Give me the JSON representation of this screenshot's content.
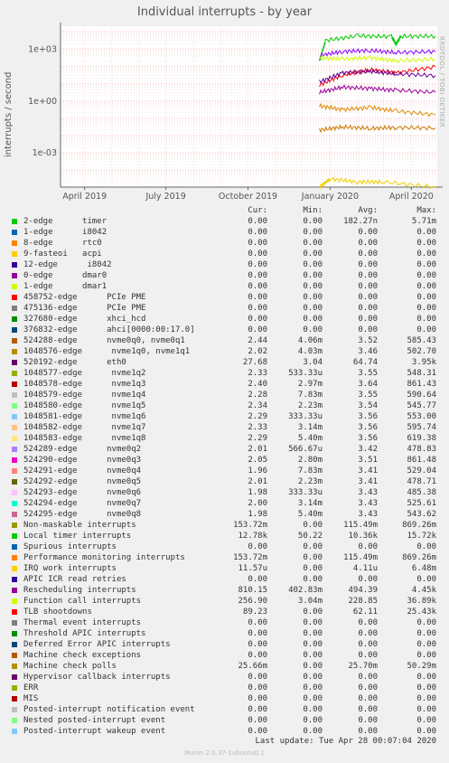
{
  "header": {
    "title": "Individual interrupts - by year",
    "side_label": "RRDTOOL / TOBI OETIKER",
    "footer": "Munin 2.0.37-1ubuntu0.1",
    "last_update": "Last update: Tue Apr 28 00:07:04 2020"
  },
  "legend_header": {
    "cur": "Cur:",
    "min": "Min:",
    "avg": "Avg:",
    "max": "Max:"
  },
  "chart_data": {
    "type": "line",
    "ylabel": "interrupts / second",
    "yscale": "log",
    "yticks": [
      "1e+03",
      "1e+00",
      "1e-03"
    ],
    "xticks": [
      "April 2019",
      "July 2019",
      "October 2019",
      "January 2020",
      "April 2020"
    ],
    "grid": true,
    "series": [
      {
        "name": "Local timer interrupts",
        "color": "#00cc00",
        "values": [
          {
            "x": "2019-12-20",
            "y": 200
          },
          {
            "x": "2019-12-27",
            "y": 3000
          },
          {
            "x": "2020-02-01",
            "y": 5500
          },
          {
            "x": "2020-03-10",
            "y": 5000
          },
          {
            "x": "2020-03-15",
            "y": 1800
          },
          {
            "x": "2020-03-20",
            "y": 5200
          },
          {
            "x": "2020-04-28",
            "y": 5300
          }
        ]
      },
      {
        "name": "Rescheduling interrupts",
        "color": "#8800ff",
        "values": [
          {
            "x": "2019-12-20",
            "y": 400
          },
          {
            "x": "2020-01-15",
            "y": 700
          },
          {
            "x": "2020-02-15",
            "y": 800
          },
          {
            "x": "2020-03-15",
            "y": 600
          },
          {
            "x": "2020-04-28",
            "y": 700
          }
        ]
      },
      {
        "name": "Function call interrupts",
        "color": "#ccff00",
        "values": [
          {
            "x": "2019-12-20",
            "y": 300
          },
          {
            "x": "2020-01-15",
            "y": 250
          },
          {
            "x": "2020-02-15",
            "y": 300
          },
          {
            "x": "2020-03-15",
            "y": 200
          },
          {
            "x": "2020-04-28",
            "y": 250
          }
        ]
      },
      {
        "name": "TLB shootdowns",
        "color": "#ff0000",
        "values": [
          {
            "x": "2019-12-20",
            "y": 8
          },
          {
            "x": "2020-01-15",
            "y": 30
          },
          {
            "x": "2020-02-15",
            "y": 60
          },
          {
            "x": "2020-03-15",
            "y": 40
          },
          {
            "x": "2020-04-28",
            "y": 90
          }
        ]
      },
      {
        "name": "520192-edge eth0",
        "color": "#660099",
        "values": [
          {
            "x": "2019-12-20",
            "y": 12
          },
          {
            "x": "2020-01-15",
            "y": 40
          },
          {
            "x": "2020-02-15",
            "y": 50
          },
          {
            "x": "2020-03-15",
            "y": 35
          },
          {
            "x": "2020-04-28",
            "y": 28
          }
        ]
      },
      {
        "name": "1048578-edge nvme1q3",
        "color": "#990099",
        "values": [
          {
            "x": "2019-12-20",
            "y": 3
          },
          {
            "x": "2020-01-15",
            "y": 6
          },
          {
            "x": "2020-02-15",
            "y": 5
          },
          {
            "x": "2020-03-15",
            "y": 4
          },
          {
            "x": "2020-04-28",
            "y": 3
          }
        ]
      },
      {
        "name": "Machine check polls",
        "color": "#cc7700",
        "values": [
          {
            "x": "2019-12-20",
            "y": 0.02
          },
          {
            "x": "2020-01-15",
            "y": 0.03
          },
          {
            "x": "2020-02-15",
            "y": 0.025
          },
          {
            "x": "2020-03-15",
            "y": 0.028
          },
          {
            "x": "2020-04-28",
            "y": 0.026
          }
        ]
      },
      {
        "name": "Performance monitoring interrupts",
        "color": "#dd8800",
        "values": [
          {
            "x": "2019-12-20",
            "y": 0.5
          },
          {
            "x": "2020-01-15",
            "y": 0.3
          },
          {
            "x": "2020-02-15",
            "y": 0.4
          },
          {
            "x": "2020-03-15",
            "y": 0.25
          },
          {
            "x": "2020-04-28",
            "y": 0.15
          }
        ]
      },
      {
        "name": "9-fasteoi acpi",
        "color": "#eecc00",
        "values": [
          {
            "x": "2019-12-20",
            "y": 1e-05
          },
          {
            "x": "2020-01-01",
            "y": 3e-05
          },
          {
            "x": "2020-02-01",
            "y": 2e-05
          },
          {
            "x": "2020-03-01",
            "y": 2e-05
          },
          {
            "x": "2020-04-28",
            "y": 1e-05
          }
        ]
      }
    ]
  },
  "legend": [
    {
      "name": "2-edge      timer",
      "color": "#00cc00",
      "cur": "0.00",
      "min": "0.00",
      "avg": "182.27n",
      "max": "5.71m"
    },
    {
      "name": "1-edge      i8042",
      "color": "#0066b3",
      "cur": "0.00",
      "min": "0.00",
      "avg": "0.00",
      "max": "0.00"
    },
    {
      "name": "8-edge      rtc0",
      "color": "#ff8000",
      "cur": "0.00",
      "min": "0.00",
      "avg": "0.00",
      "max": "0.00"
    },
    {
      "name": "9-fasteoi   acpi",
      "color": "#ffcc00",
      "cur": "0.00",
      "min": "0.00",
      "avg": "0.00",
      "max": "0.00"
    },
    {
      "name": "12-edge      i8042",
      "color": "#330099",
      "cur": "0.00",
      "min": "0.00",
      "avg": "0.00",
      "max": "0.00"
    },
    {
      "name": "0-edge      dmar0",
      "color": "#990099",
      "cur": "0.00",
      "min": "0.00",
      "avg": "0.00",
      "max": "0.00"
    },
    {
      "name": "1-edge      dmar1",
      "color": "#ccff00",
      "cur": "0.00",
      "min": "0.00",
      "avg": "0.00",
      "max": "0.00"
    },
    {
      "name": "458752-edge      PCIe PME",
      "color": "#ff0000",
      "cur": "0.00",
      "min": "0.00",
      "avg": "0.00",
      "max": "0.00"
    },
    {
      "name": "475136-edge      PCIe PME",
      "color": "#808080",
      "cur": "0.00",
      "min": "0.00",
      "avg": "0.00",
      "max": "0.00"
    },
    {
      "name": "327680-edge      xhci_hcd",
      "color": "#008f00",
      "cur": "0.00",
      "min": "0.00",
      "avg": "0.00",
      "max": "0.00"
    },
    {
      "name": "376832-edge      ahci[0000:00:17.0]",
      "color": "#00487d",
      "cur": "0.00",
      "min": "0.00",
      "avg": "0.00",
      "max": "0.00"
    },
    {
      "name": "524288-edge      nvme0q0, nvme0q1",
      "color": "#b35a00",
      "cur": "2.44",
      "min": "4.06m",
      "avg": "3.52",
      "max": "585.43"
    },
    {
      "name": "1048576-edge      nvme1q0, nvme1q1",
      "color": "#b38f00",
      "cur": "2.02",
      "min": "4.03m",
      "avg": "3.46",
      "max": "502.70"
    },
    {
      "name": "520192-edge      eth0",
      "color": "#6b006b",
      "cur": "27.68",
      "min": "3.04",
      "avg": "64.74",
      "max": "3.95k"
    },
    {
      "name": "1048577-edge      nvme1q2",
      "color": "#8fb300",
      "cur": "2.33",
      "min": "533.33u",
      "avg": "3.55",
      "max": "548.31"
    },
    {
      "name": "1048578-edge      nvme1q3",
      "color": "#b30000",
      "cur": "2.40",
      "min": "2.97m",
      "avg": "3.64",
      "max": "861.43"
    },
    {
      "name": "1048579-edge      nvme1q4",
      "color": "#bebebe",
      "cur": "2.28",
      "min": "7.83m",
      "avg": "3.55",
      "max": "590.64"
    },
    {
      "name": "1048580-edge      nvme1q5",
      "color": "#80ff80",
      "cur": "2.34",
      "min": "2.23m",
      "avg": "3.54",
      "max": "545.77"
    },
    {
      "name": "1048581-edge      nvme1q6",
      "color": "#80c9ff",
      "cur": "2.29",
      "min": "333.33u",
      "avg": "3.56",
      "max": "553.00"
    },
    {
      "name": "1048582-edge      nvme1q7",
      "color": "#ffc080",
      "cur": "2.33",
      "min": "3.14m",
      "avg": "3.56",
      "max": "595.74"
    },
    {
      "name": "1048583-edge      nvme1q8",
      "color": "#ffe680",
      "cur": "2.29",
      "min": "5.40m",
      "avg": "3.56",
      "max": "619.38"
    },
    {
      "name": "524289-edge      nvme0q2",
      "color": "#aa80ff",
      "cur": "2.01",
      "min": "566.67u",
      "avg": "3.42",
      "max": "478.83"
    },
    {
      "name": "524290-edge      nvme0q3",
      "color": "#ee00cc",
      "cur": "2.05",
      "min": "2.80m",
      "avg": "3.51",
      "max": "861.48"
    },
    {
      "name": "524291-edge      nvme0q4",
      "color": "#ff8080",
      "cur": "1.96",
      "min": "7.83m",
      "avg": "3.41",
      "max": "529.04"
    },
    {
      "name": "524292-edge      nvme0q5",
      "color": "#666600",
      "cur": "2.01",
      "min": "2.23m",
      "avg": "3.41",
      "max": "478.71"
    },
    {
      "name": "524293-edge      nvme0q6",
      "color": "#ffbfff",
      "cur": "1.98",
      "min": "333.33u",
      "avg": "3.43",
      "max": "485.38"
    },
    {
      "name": "524294-edge      nvme0q7",
      "color": "#00ffcc",
      "cur": "2.00",
      "min": "3.14m",
      "avg": "3.43",
      "max": "525.61"
    },
    {
      "name": "524295-edge      nvme0q8",
      "color": "#cc6699",
      "cur": "1.98",
      "min": "5.40m",
      "avg": "3.43",
      "max": "543.62"
    },
    {
      "name": "Non-maskable interrupts",
      "color": "#999900",
      "cur": "153.72m",
      "min": "0.00",
      "avg": "115.49m",
      "max": "869.26m"
    },
    {
      "name": "Local timer interrupts",
      "color": "#00cc00",
      "cur": "12.78k",
      "min": "50.22",
      "avg": "10.36k",
      "max": "15.72k"
    },
    {
      "name": "Spurious interrupts",
      "color": "#0066b3",
      "cur": "0.00",
      "min": "0.00",
      "avg": "0.00",
      "max": "0.00"
    },
    {
      "name": "Performance monitoring interrupts",
      "color": "#ff8000",
      "cur": "153.72m",
      "min": "0.00",
      "avg": "115.49m",
      "max": "869.26m"
    },
    {
      "name": "IRQ work interrupts",
      "color": "#ffcc00",
      "cur": "11.57u",
      "min": "0.00",
      "avg": "4.11u",
      "max": "6.48m"
    },
    {
      "name": "APIC ICR read retries",
      "color": "#330099",
      "cur": "0.00",
      "min": "0.00",
      "avg": "0.00",
      "max": "0.00"
    },
    {
      "name": "Rescheduling interrupts",
      "color": "#990099",
      "cur": "810.15",
      "min": "402.83m",
      "avg": "494.39",
      "max": "4.45k"
    },
    {
      "name": "Function call interrupts",
      "color": "#ccff00",
      "cur": "256.90",
      "min": "3.04m",
      "avg": "228.85",
      "max": "36.89k"
    },
    {
      "name": "TLB shootdowns",
      "color": "#ff0000",
      "cur": "89.23",
      "min": "0.00",
      "avg": "62.11",
      "max": "25.43k"
    },
    {
      "name": "Thermal event interrupts",
      "color": "#808080",
      "cur": "0.00",
      "min": "0.00",
      "avg": "0.00",
      "max": "0.00"
    },
    {
      "name": "Threshold APIC interrupts",
      "color": "#008f00",
      "cur": "0.00",
      "min": "0.00",
      "avg": "0.00",
      "max": "0.00"
    },
    {
      "name": "Deferred Error APIC interrupts",
      "color": "#00487d",
      "cur": "0.00",
      "min": "0.00",
      "avg": "0.00",
      "max": "0.00"
    },
    {
      "name": "Machine check exceptions",
      "color": "#b35a00",
      "cur": "0.00",
      "min": "0.00",
      "avg": "0.00",
      "max": "0.00"
    },
    {
      "name": "Machine check polls",
      "color": "#b38f00",
      "cur": "25.66m",
      "min": "0.00",
      "avg": "25.70m",
      "max": "50.29m"
    },
    {
      "name": "Hypervisor callback interrupts",
      "color": "#6b006b",
      "cur": "0.00",
      "min": "0.00",
      "avg": "0.00",
      "max": "0.00"
    },
    {
      "name": "ERR",
      "color": "#8fb300",
      "cur": "0.00",
      "min": "0.00",
      "avg": "0.00",
      "max": "0.00"
    },
    {
      "name": "MIS",
      "color": "#b30000",
      "cur": "0.00",
      "min": "0.00",
      "avg": "0.00",
      "max": "0.00"
    },
    {
      "name": "Posted-interrupt notification event",
      "color": "#bebebe",
      "cur": "0.00",
      "min": "0.00",
      "avg": "0.00",
      "max": "0.00"
    },
    {
      "name": "Nested posted-interrupt event",
      "color": "#80ff80",
      "cur": "0.00",
      "min": "0.00",
      "avg": "0.00",
      "max": "0.00"
    },
    {
      "name": "Posted-interrupt wakeup event",
      "color": "#80c9ff",
      "cur": "0.00",
      "min": "0.00",
      "avg": "0.00",
      "max": "0.00"
    }
  ]
}
